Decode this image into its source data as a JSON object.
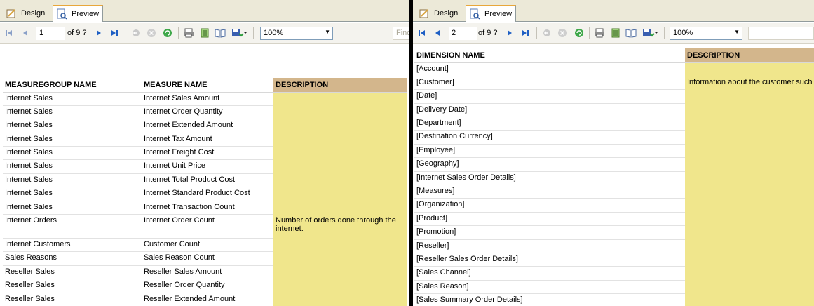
{
  "left": {
    "tabs": {
      "design": "Design",
      "preview": "Preview"
    },
    "toolbar": {
      "page": "1",
      "of_label": "of 9 ?",
      "zoom": "100%",
      "find_placeholder": "Find"
    },
    "table": {
      "headers": [
        "MEASUREGROUP NAME",
        "MEASURE NAME",
        "DESCRIPTION"
      ],
      "rows": [
        [
          "Internet Sales",
          "Internet Sales Amount",
          ""
        ],
        [
          "Internet Sales",
          "Internet Order Quantity",
          ""
        ],
        [
          "Internet Sales",
          "Internet Extended Amount",
          ""
        ],
        [
          "Internet Sales",
          "Internet Tax Amount",
          ""
        ],
        [
          "Internet Sales",
          "Internet Freight Cost",
          ""
        ],
        [
          "Internet Sales",
          "Internet Unit Price",
          ""
        ],
        [
          "Internet Sales",
          "Internet Total Product Cost",
          ""
        ],
        [
          "Internet Sales",
          "Internet Standard Product Cost",
          ""
        ],
        [
          "Internet Sales",
          "Internet Transaction Count",
          ""
        ],
        [
          "Internet Orders",
          "Internet Order Count",
          "Number of orders done through the internet."
        ],
        [
          "Internet Customers",
          "Customer Count",
          ""
        ],
        [
          "Sales Reasons",
          "Sales Reason Count",
          ""
        ],
        [
          "Reseller Sales",
          "Reseller Sales Amount",
          ""
        ],
        [
          "Reseller Sales",
          "Reseller Order Quantity",
          ""
        ],
        [
          "Reseller Sales",
          "Reseller Extended Amount",
          ""
        ]
      ]
    }
  },
  "right": {
    "tabs": {
      "design": "Design",
      "preview": "Preview"
    },
    "toolbar": {
      "page": "2",
      "of_label": "of 9 ?",
      "zoom": "100%"
    },
    "table": {
      "headers": [
        "DIMENSION NAME",
        "DESCRIPTION"
      ],
      "rows": [
        [
          "[Account]",
          ""
        ],
        [
          "[Customer]",
          "Information about the customer such"
        ],
        [
          "[Date]",
          ""
        ],
        [
          "[Delivery Date]",
          ""
        ],
        [
          "[Department]",
          ""
        ],
        [
          "[Destination Currency]",
          ""
        ],
        [
          "[Employee]",
          ""
        ],
        [
          "[Geography]",
          ""
        ],
        [
          "[Internet Sales Order Details]",
          ""
        ],
        [
          "[Measures]",
          ""
        ],
        [
          "[Organization]",
          ""
        ],
        [
          "[Product]",
          ""
        ],
        [
          "[Promotion]",
          ""
        ],
        [
          "[Reseller]",
          ""
        ],
        [
          "[Reseller Sales Order Details]",
          ""
        ],
        [
          "[Sales Channel]",
          ""
        ],
        [
          "[Sales Reason]",
          ""
        ],
        [
          "[Sales Summary Order Details]",
          ""
        ]
      ]
    }
  },
  "colors": {
    "description_header": "#d3b68c",
    "description_cell": "#f0e68c",
    "divider": "#000000"
  }
}
